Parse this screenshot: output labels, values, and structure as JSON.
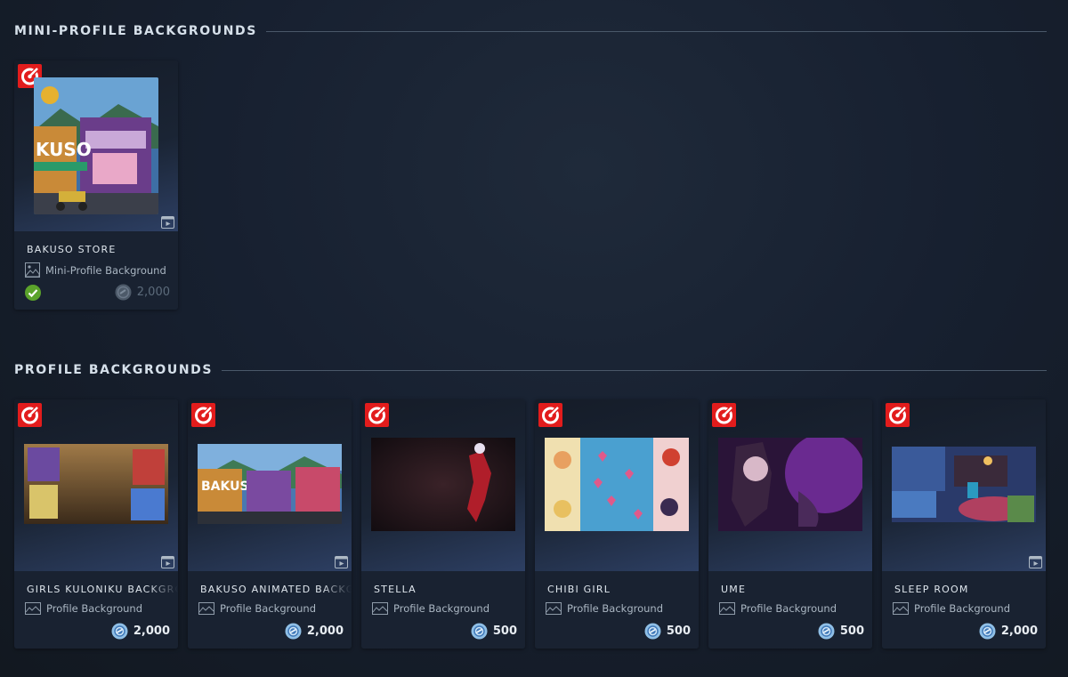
{
  "sections": {
    "mini": {
      "title": "MINI-PROFILE BACKGROUNDS"
    },
    "profile": {
      "title": "PROFILE BACKGROUNDS"
    }
  },
  "mini_items": [
    {
      "name": "BAKUSO STORE",
      "type": "Mini-Profile Background",
      "price": "2,000",
      "owned": true,
      "animated": true
    }
  ],
  "profile_items": [
    {
      "name": "GIRLS KULONIKU BACKGROUND",
      "type": "Profile Background",
      "price": "2,000",
      "animated": true
    },
    {
      "name": "BAKUSO ANIMATED BACKGROUND",
      "type": "Profile Background",
      "price": "2,000",
      "animated": true
    },
    {
      "name": "STELLA",
      "type": "Profile Background",
      "price": "500",
      "animated": false
    },
    {
      "name": "CHIBI GIRL",
      "type": "Profile Background",
      "price": "500",
      "animated": false
    },
    {
      "name": "UME",
      "type": "Profile Background",
      "price": "500",
      "animated": false
    },
    {
      "name": "SLEEP ROOM",
      "type": "Profile Background",
      "price": "2,000",
      "animated": true
    }
  ],
  "icons": {
    "badge": "points-shop-badge-icon",
    "video": "animated-video-icon",
    "image": "image-type-icon",
    "coin": "steam-points-coin-icon",
    "check": "owned-check-icon"
  },
  "colors": {
    "badge": "#e21c1c",
    "owned": "#5ba32b",
    "coin": "#6fa9d8"
  }
}
